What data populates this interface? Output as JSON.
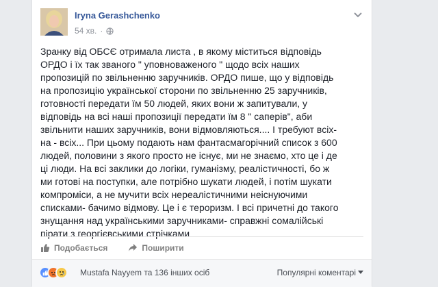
{
  "post": {
    "author": "Iryna Gerashchenko",
    "timestamp": "54 хв.",
    "text": "Зранку від ОБСЄ отримала листа , в якому міститься відповідь ОРДО і їх так званого \" уповноваженого \" щодо всіх наших пропозицій по звільненню заручників. ОРДО пише, що у відповідь на пропозицію української сторони по звільненню 25 заручників, готовності передати їм 50 людей, яких вони ж запитували, у відповідь на всі наші пропозиції передати їм 8 \" саперів\", аби звільнити наших заручників, вони відмовляються.... І требуют всіх- на - всіх... При цьому подають нам фантасмагорічний список з 600 людей, половини з якого просто не існує, ми не знаємо, хто це і де ці люди. На всі заклики до логіки, гуманізму, реалістичності, бо ж ми готові на поступки, але потрібно шукати людей, і потім шукати компроміси, а не мучити всіх нереалістичними неіснуючими списками- бачимо відмову. Це і є тероризм. І всі причетні до такого знущання над українськими заручниками- справжні сомалійські пірати з георгієвськими стрічками"
  },
  "actions": {
    "like_label": "Подобається",
    "share_label": "Поширити"
  },
  "reactions": {
    "icons": [
      "like-icon",
      "angry-icon",
      "sad-icon"
    ],
    "summary": "Mustafa Nayyem та 136 інших осіб"
  },
  "comments": {
    "sort_label": "Популярні коментарі"
  },
  "colors": {
    "link": "#365899",
    "like": "#5890ff",
    "angry": "#f0742c",
    "sad": "#f7c94b"
  }
}
